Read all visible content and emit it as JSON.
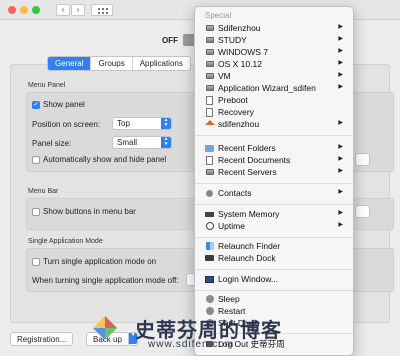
{
  "window": {
    "title": "",
    "nav_back": "‹",
    "nav_forward": "›"
  },
  "toggle": {
    "label": "OFF"
  },
  "tabs": [
    {
      "label": "General",
      "active": true
    },
    {
      "label": "Groups"
    },
    {
      "label": "Applications"
    }
  ],
  "menu_panel": {
    "title": "Menu Panel",
    "show_panel": "Show panel",
    "position_label": "Position on screen:",
    "position_value": "Top",
    "panel_size_label": "Panel size:",
    "panel_size_value": "Small",
    "auto_show": "Automatically show and hide panel"
  },
  "menu_bar": {
    "title": "Menu Bar",
    "show_buttons": "Show buttons in menu bar"
  },
  "single_app": {
    "title": "Single Application Mode",
    "turn_on": "Turn single application mode on",
    "when_off": "When turning single application mode off:"
  },
  "bottom": {
    "registration": "Registration...",
    "backup": "Back up"
  },
  "menu": {
    "header": "Special",
    "volumes": [
      {
        "label": "Sdifenzhou",
        "icon": "disk-icon",
        "submenu": true
      },
      {
        "label": "STUDY",
        "icon": "disk-icon",
        "submenu": true
      },
      {
        "label": "WINDOWS 7",
        "icon": "disk-icon",
        "submenu": true
      },
      {
        "label": "OS X 10.12",
        "icon": "disk-icon",
        "submenu": true
      },
      {
        "label": "VM",
        "icon": "disk-icon",
        "submenu": true
      },
      {
        "label": "Application Wizard_sdifen",
        "icon": "disk-icon",
        "submenu": true
      },
      {
        "label": "Preboot",
        "icon": "document-icon",
        "submenu": false
      },
      {
        "label": "Recovery",
        "icon": "document-icon",
        "submenu": false
      },
      {
        "label": "sdifenzhou",
        "icon": "home-icon",
        "submenu": true
      }
    ],
    "recents": [
      {
        "label": "Recent Folders",
        "icon": "folder-icon"
      },
      {
        "label": "Recent Documents",
        "icon": "document-icon"
      },
      {
        "label": "Recent Servers",
        "icon": "server-icon"
      }
    ],
    "contacts": {
      "label": "Contacts"
    },
    "system": [
      {
        "label": "System Memory",
        "icon": "ram-icon"
      },
      {
        "label": "Uptime",
        "icon": "clock-icon"
      }
    ],
    "relaunch": [
      {
        "label": "Relaunch Finder",
        "icon": "finder-icon"
      },
      {
        "label": "Relaunch Dock",
        "icon": "dock-icon"
      }
    ],
    "login_window": {
      "label": "Login Window..."
    },
    "power": [
      {
        "label": "Sleep",
        "icon": "sleep-icon"
      },
      {
        "label": "Restart",
        "icon": "restart-icon"
      },
      {
        "label": "Shut Down",
        "icon": "shutdown-icon"
      },
      {
        "label": "Log Out 史蒂芬周",
        "icon": "logout-icon"
      }
    ]
  },
  "watermark": {
    "text": "史蒂芬周的博客",
    "url": "www.sdifen.com"
  },
  "colors": {
    "accent": "#2f7ff5",
    "menu_bg": "#f6f6f6"
  }
}
